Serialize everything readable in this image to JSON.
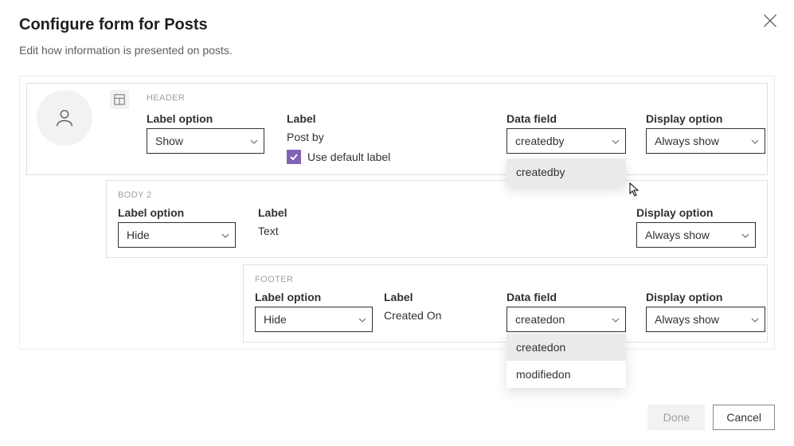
{
  "dialog": {
    "title": "Configure form for Posts",
    "subtitle": "Edit how information is presented on posts.",
    "close": "close"
  },
  "headerCard": {
    "section": "HEADER",
    "labelOption": {
      "label": "Label option",
      "value": "Show"
    },
    "label": {
      "label": "Label",
      "value": "Post by"
    },
    "useDefault": "Use default label",
    "dataField": {
      "label": "Data field",
      "value": "createdby",
      "options": [
        "createdby"
      ]
    },
    "displayOption": {
      "label": "Display option",
      "value": "Always show"
    }
  },
  "body2Card": {
    "section": "BODY 2",
    "labelOption": {
      "label": "Label option",
      "value": "Hide"
    },
    "label": {
      "label": "Label",
      "value": "Text"
    },
    "displayOption": {
      "label": "Display option",
      "value": "Always show"
    }
  },
  "footerCard": {
    "section": "FOOTER",
    "labelOption": {
      "label": "Label option",
      "value": "Hide"
    },
    "label": {
      "label": "Label",
      "value": "Created On"
    },
    "dataField": {
      "label": "Data field",
      "value": "createdon",
      "options": [
        "createdon",
        "modifiedon"
      ]
    },
    "displayOption": {
      "label": "Display option",
      "value": "Always show"
    }
  },
  "buttons": {
    "done": "Done",
    "cancel": "Cancel"
  }
}
